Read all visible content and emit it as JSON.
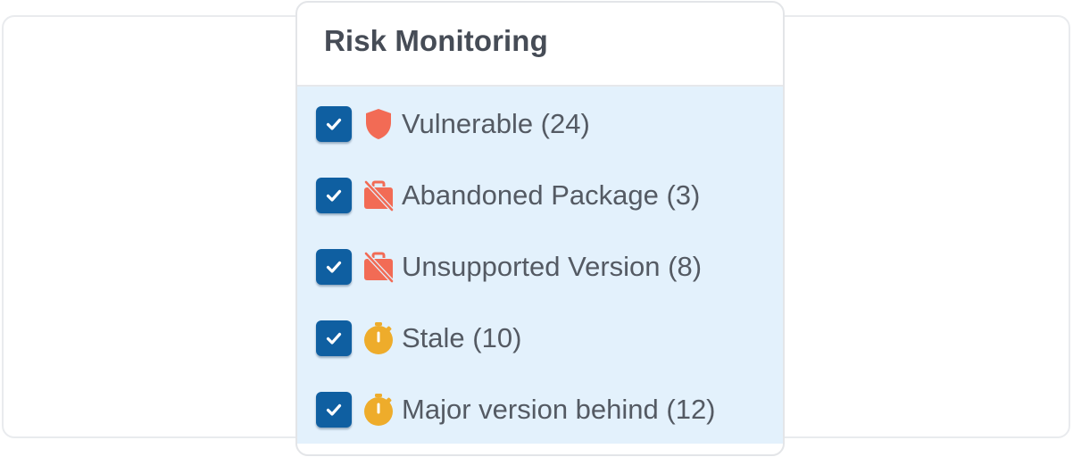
{
  "panel": {
    "title": "Risk Monitoring"
  },
  "filters": [
    {
      "label": "Vulnerable (24)",
      "checked": true,
      "icon": "shield-icon",
      "icon_color": "#f26b55"
    },
    {
      "label": "Abandoned Package (3)",
      "checked": true,
      "icon": "briefcase-off-icon",
      "icon_color": "#f26b55"
    },
    {
      "label": "Unsupported Version (8)",
      "checked": true,
      "icon": "briefcase-off-icon",
      "icon_color": "#f26b55"
    },
    {
      "label": "Stale (10)",
      "checked": true,
      "icon": "stopwatch-icon",
      "icon_color": "#eeac2b"
    },
    {
      "label": "Major version behind (12)",
      "checked": true,
      "icon": "stopwatch-icon",
      "icon_color": "#eeac2b"
    }
  ],
  "colors": {
    "checkbox": "#0f5fa1",
    "list_background": "#e3f1fc",
    "danger": "#f26b55",
    "warning": "#eeac2b"
  }
}
